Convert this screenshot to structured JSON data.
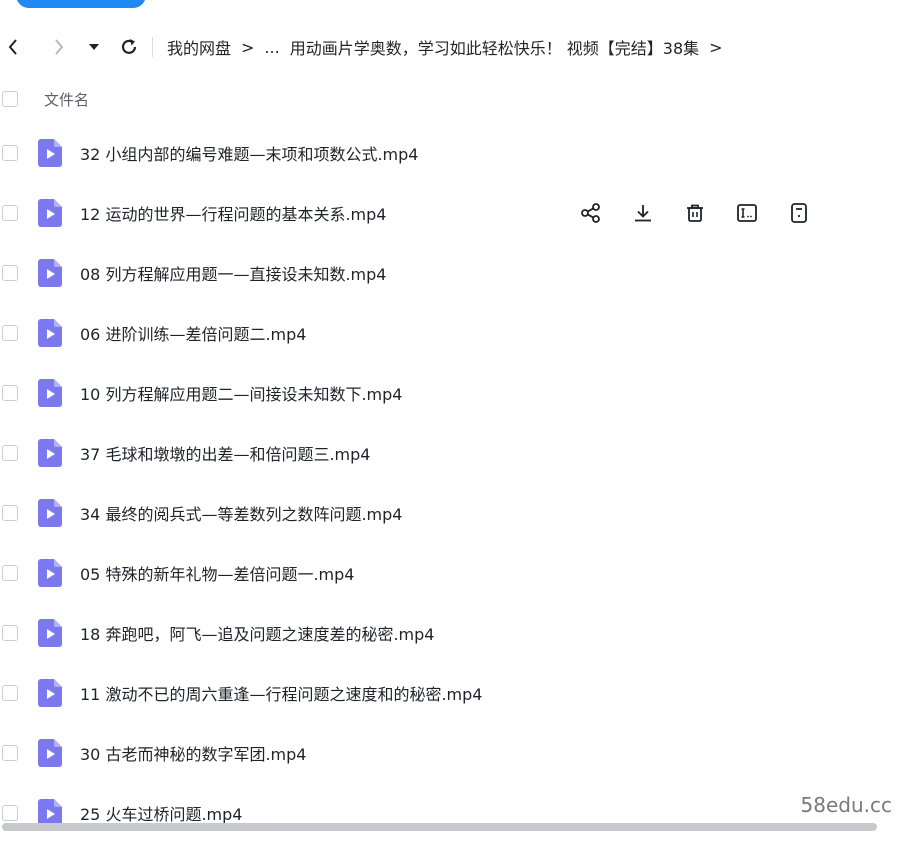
{
  "breadcrumb": {
    "items": [
      "我的网盘",
      "...",
      "用动画片学奥数，学习如此轻松快乐！ 视频【完结】38集"
    ],
    "separator": ">"
  },
  "list_header": {
    "name_column": "文件名"
  },
  "files": [
    "32 小组内部的编号难题—末项和项数公式.mp4",
    "12 运动的世界—行程问题的基本关系.mp4",
    "08 列方程解应用题一—直接设未知数.mp4",
    "06 进阶训练—差倍问题二.mp4",
    "10 列方程解应用题二—间接设未知数下.mp4",
    "37 毛球和墩墩的出差—和倍问题三.mp4",
    "34 最终的阅兵式—等差数列之数阵问题.mp4",
    "05 特殊的新年礼物—差倍问题一.mp4",
    "18 奔跑吧，阿飞—追及问题之速度差的秘密.mp4",
    "11 激动不已的周六重逢—行程问题之速度和的秘密.mp4",
    "30 古老而神秘的数字军团.mp4",
    "25 火车过桥问题.mp4"
  ],
  "row_action_icons": [
    "share-icon",
    "download-icon",
    "delete-icon",
    "rename-icon",
    "more-icon"
  ],
  "watermark": "58edu.cc",
  "colors": {
    "accent": "#1e88f5",
    "file_icon": "#7b78f0",
    "text": "#1f2329"
  }
}
